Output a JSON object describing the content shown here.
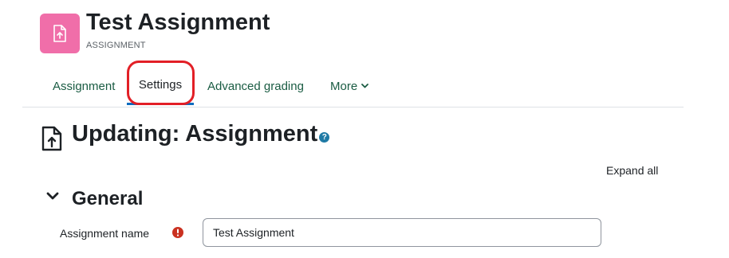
{
  "header": {
    "activity_title": "Test Assignment",
    "activity_type": "ASSIGNMENT",
    "icon": "file-upload-icon",
    "icon_bg": "#f06ea9"
  },
  "tabs": [
    {
      "label": "Assignment",
      "active": false
    },
    {
      "label": "Settings",
      "active": true
    },
    {
      "label": "Advanced grading",
      "active": false
    },
    {
      "label": "More",
      "active": false,
      "dropdown": true
    }
  ],
  "page": {
    "heading": "Updating: Assignment",
    "expand_all_label": "Expand all"
  },
  "section": {
    "title": "General",
    "expanded": true
  },
  "form": {
    "assignment_name_label": "Assignment name",
    "assignment_name_value": "Test Assignment",
    "required": true
  },
  "colors": {
    "link": "#1a5c43",
    "highlight": "#e21f26",
    "help_icon": "#1f7aa5",
    "required_icon": "#ca3120"
  }
}
